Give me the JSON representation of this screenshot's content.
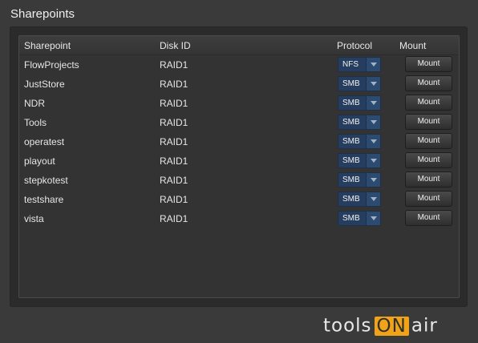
{
  "title": "Sharepoints",
  "table": {
    "headers": {
      "sharepoint": "Sharepoint",
      "disk_id": "Disk ID",
      "protocol": "Protocol",
      "mount": "Mount"
    },
    "rows": [
      {
        "sharepoint": "FlowProjects",
        "disk_id": "RAID1",
        "protocol": "NFS",
        "mount_label": "Mount"
      },
      {
        "sharepoint": "JustStore",
        "disk_id": "RAID1",
        "protocol": "SMB",
        "mount_label": "Mount"
      },
      {
        "sharepoint": "NDR",
        "disk_id": "RAID1",
        "protocol": "SMB",
        "mount_label": "Mount"
      },
      {
        "sharepoint": "Tools",
        "disk_id": "RAID1",
        "protocol": "SMB",
        "mount_label": "Mount"
      },
      {
        "sharepoint": "operatest",
        "disk_id": "RAID1",
        "protocol": "SMB",
        "mount_label": "Mount"
      },
      {
        "sharepoint": "playout",
        "disk_id": "RAID1",
        "protocol": "SMB",
        "mount_label": "Mount"
      },
      {
        "sharepoint": "stepkotest",
        "disk_id": "RAID1",
        "protocol": "SMB",
        "mount_label": "Mount"
      },
      {
        "sharepoint": "testshare",
        "disk_id": "RAID1",
        "protocol": "SMB",
        "mount_label": "Mount"
      },
      {
        "sharepoint": "vista",
        "disk_id": "RAID1",
        "protocol": "SMB",
        "mount_label": "Mount"
      }
    ]
  },
  "brand": {
    "part1": "tools",
    "part2": "ON",
    "part3": "air"
  },
  "colors": {
    "background": "#3a3a3a",
    "panel": "#2b2b2b",
    "select": "#253e5f",
    "brand_accent": "#f0a318"
  }
}
